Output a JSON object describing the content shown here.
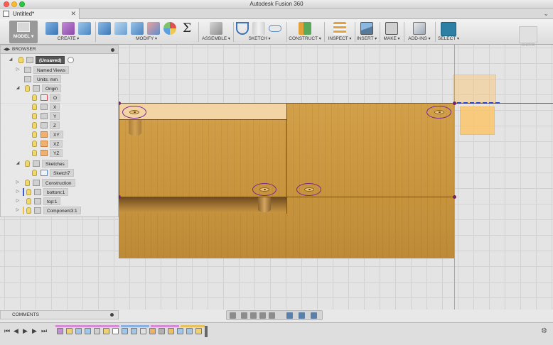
{
  "window": {
    "title": "Autodesk Fusion 360"
  },
  "tabs": [
    {
      "label": "Untitled*",
      "close": "✕"
    }
  ],
  "tab_overflow": "⌄",
  "toolbar": {
    "model_label": "MODEL ▾",
    "groups": [
      {
        "label": "CREATE"
      },
      {
        "label": "MODIFY"
      },
      {
        "label": "ASSEMBLE"
      },
      {
        "label": "SKETCH"
      },
      {
        "label": "CONSTRUCT"
      },
      {
        "label": "INSPECT"
      },
      {
        "label": "INSERT"
      },
      {
        "label": "MAKE"
      },
      {
        "label": "ADD-INS"
      },
      {
        "label": "SELECT"
      }
    ],
    "sigma": "Σ"
  },
  "viewcube": {
    "label": "SHDIR"
  },
  "browser": {
    "title": "BROWSER",
    "items": [
      {
        "label": "(Unsaved)"
      },
      {
        "label": "Named Views"
      },
      {
        "label": "Units: mm"
      },
      {
        "label": "Origin"
      },
      {
        "label": "O"
      },
      {
        "label": "X"
      },
      {
        "label": "Y"
      },
      {
        "label": "Z"
      },
      {
        "label": "XY"
      },
      {
        "label": "XZ"
      },
      {
        "label": "YZ"
      },
      {
        "label": "Sketches"
      },
      {
        "label": "Sketch7"
      },
      {
        "label": "Construction"
      },
      {
        "label": "bottom:1"
      },
      {
        "label": "top:1"
      },
      {
        "label": "Component3:1"
      }
    ]
  },
  "comments": {
    "title": "COMMENTS"
  },
  "timeline": {
    "controls": [
      "⏮",
      "◀",
      "▶",
      "▶",
      "⏭"
    ],
    "settings": "⚙"
  },
  "colors": {
    "accent": "#2d7fa3",
    "selection": "#8a2e8a",
    "wood": "#c8953e",
    "axis_blue": "#5b55d8",
    "axis_red": "#e38a8a"
  }
}
